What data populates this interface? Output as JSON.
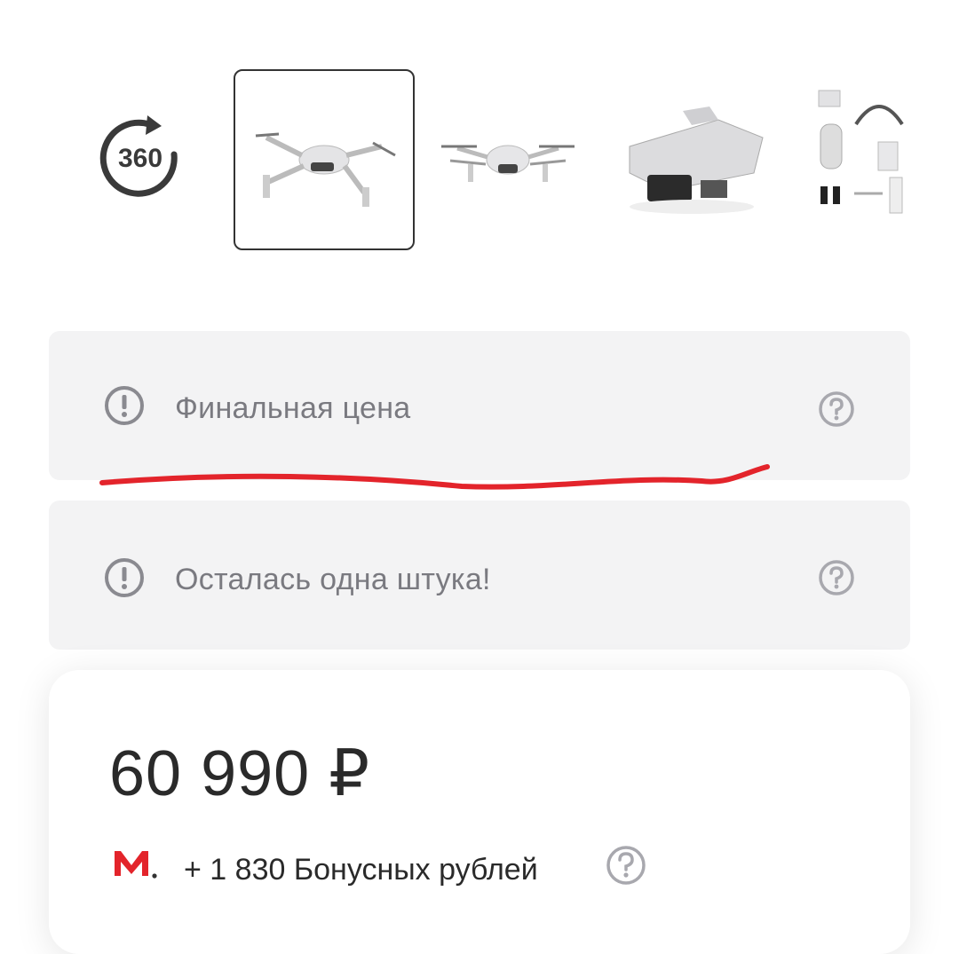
{
  "gallery": {
    "view360_label": "360",
    "thumbnails": [
      {
        "name": "drone-front-angle",
        "active": true
      },
      {
        "name": "drone-front",
        "active": false
      },
      {
        "name": "drone-folded",
        "active": false
      },
      {
        "name": "drone-kit-contents",
        "active": false
      }
    ]
  },
  "notices": [
    {
      "label": "Финальная цена"
    },
    {
      "label": "Осталась одна штука!"
    }
  ],
  "price_card": {
    "price": "60 990 ₽",
    "bonus_text": "+ 1 830 Бонусных рублей"
  },
  "colors": {
    "accent_red": "#e3242b",
    "notice_bg": "#f3f3f4",
    "icon_grey": "#8a8a90"
  },
  "icons": [
    "360-view-icon",
    "warning-icon",
    "help-icon",
    "mvideo-logo-icon"
  ]
}
